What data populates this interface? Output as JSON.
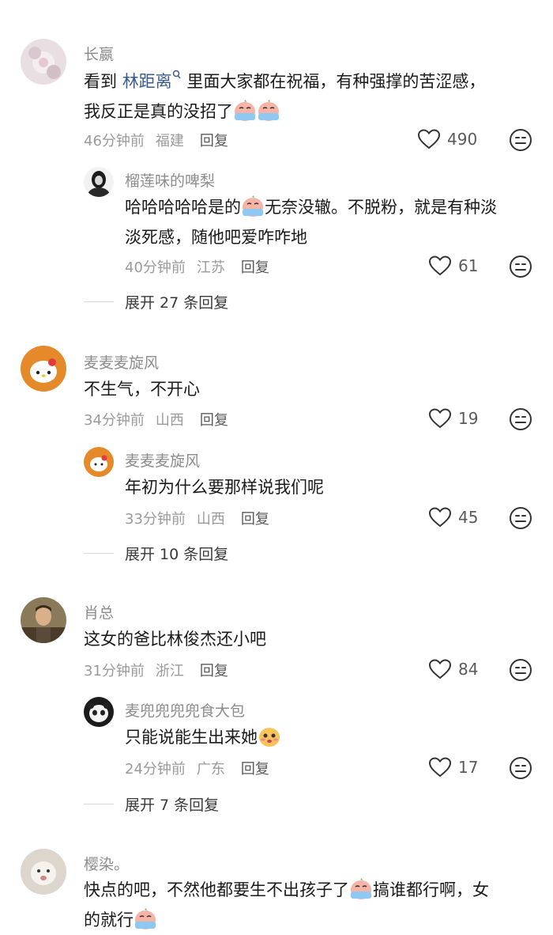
{
  "comments": [
    {
      "user": "长嬴",
      "text_pre": "看到 ",
      "mention": "林距离",
      "text_post": " 里面大家都在祝福，有种强撑的苦涩感，",
      "text_line2": "我反正是真的没招了",
      "time": "46分钟前",
      "location": "福建",
      "reply_label": "回复",
      "likes": "490",
      "reply": {
        "user": "榴莲味的啤梨",
        "text": "哈哈哈哈哈是的",
        "text_post": "无奈没辙。不脱粉，就是有种淡",
        "text_line2": "淡死感，随他吧爱咋咋地",
        "time": "40分钟前",
        "location": "江苏",
        "reply_label": "回复",
        "likes": "61"
      },
      "expand_label": "展开 27 条回复"
    },
    {
      "user": "麦麦麦旋风",
      "text": "不生气，不开心",
      "time": "34分钟前",
      "location": "山西",
      "reply_label": "回复",
      "likes": "19",
      "reply": {
        "user": "麦麦麦旋风",
        "text": "年初为什么要那样说我们呢",
        "time": "33分钟前",
        "location": "山西",
        "reply_label": "回复",
        "likes": "45"
      },
      "expand_label": "展开 10 条回复"
    },
    {
      "user": "肖总",
      "text": "这女的爸比林俊杰还小吧",
      "time": "31分钟前",
      "location": "浙江",
      "reply_label": "回复",
      "likes": "84",
      "reply": {
        "user": "麦兜兜兜兜食大包",
        "text": "只能说能生出来她",
        "time": "24分钟前",
        "location": "广东",
        "reply_label": "回复",
        "likes": "17"
      },
      "expand_label": "展开 7 条回复"
    },
    {
      "user": "樱染。",
      "text_pre": "快点的吧，不然他都要生不出孩子了",
      "text_post": "搞谁都行啊，女",
      "text_line2": "的就行"
    }
  ],
  "colors": {
    "muted": "#8c8c8c",
    "mention": "#3a5a8c",
    "divider": "#d8d8d8"
  }
}
